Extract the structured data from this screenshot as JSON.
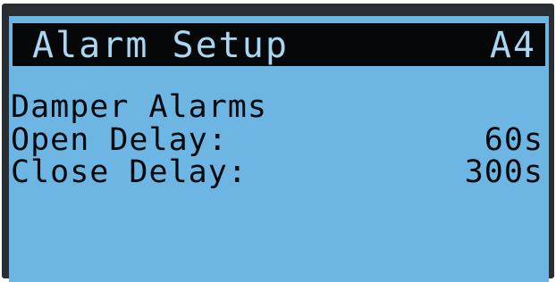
{
  "screen": {
    "header": {
      "title": "Alarm Setup",
      "code": "A4"
    },
    "section_title": "Damper Alarms",
    "settings": [
      {
        "label": "Open Delay:",
        "value": "60s"
      },
      {
        "label": "Close Delay:",
        "value": "300s"
      }
    ]
  },
  "colors": {
    "lcd_background": "#6db6e3",
    "header_background": "#050708",
    "header_text": "#a9d6f2",
    "text": "#06090c"
  }
}
